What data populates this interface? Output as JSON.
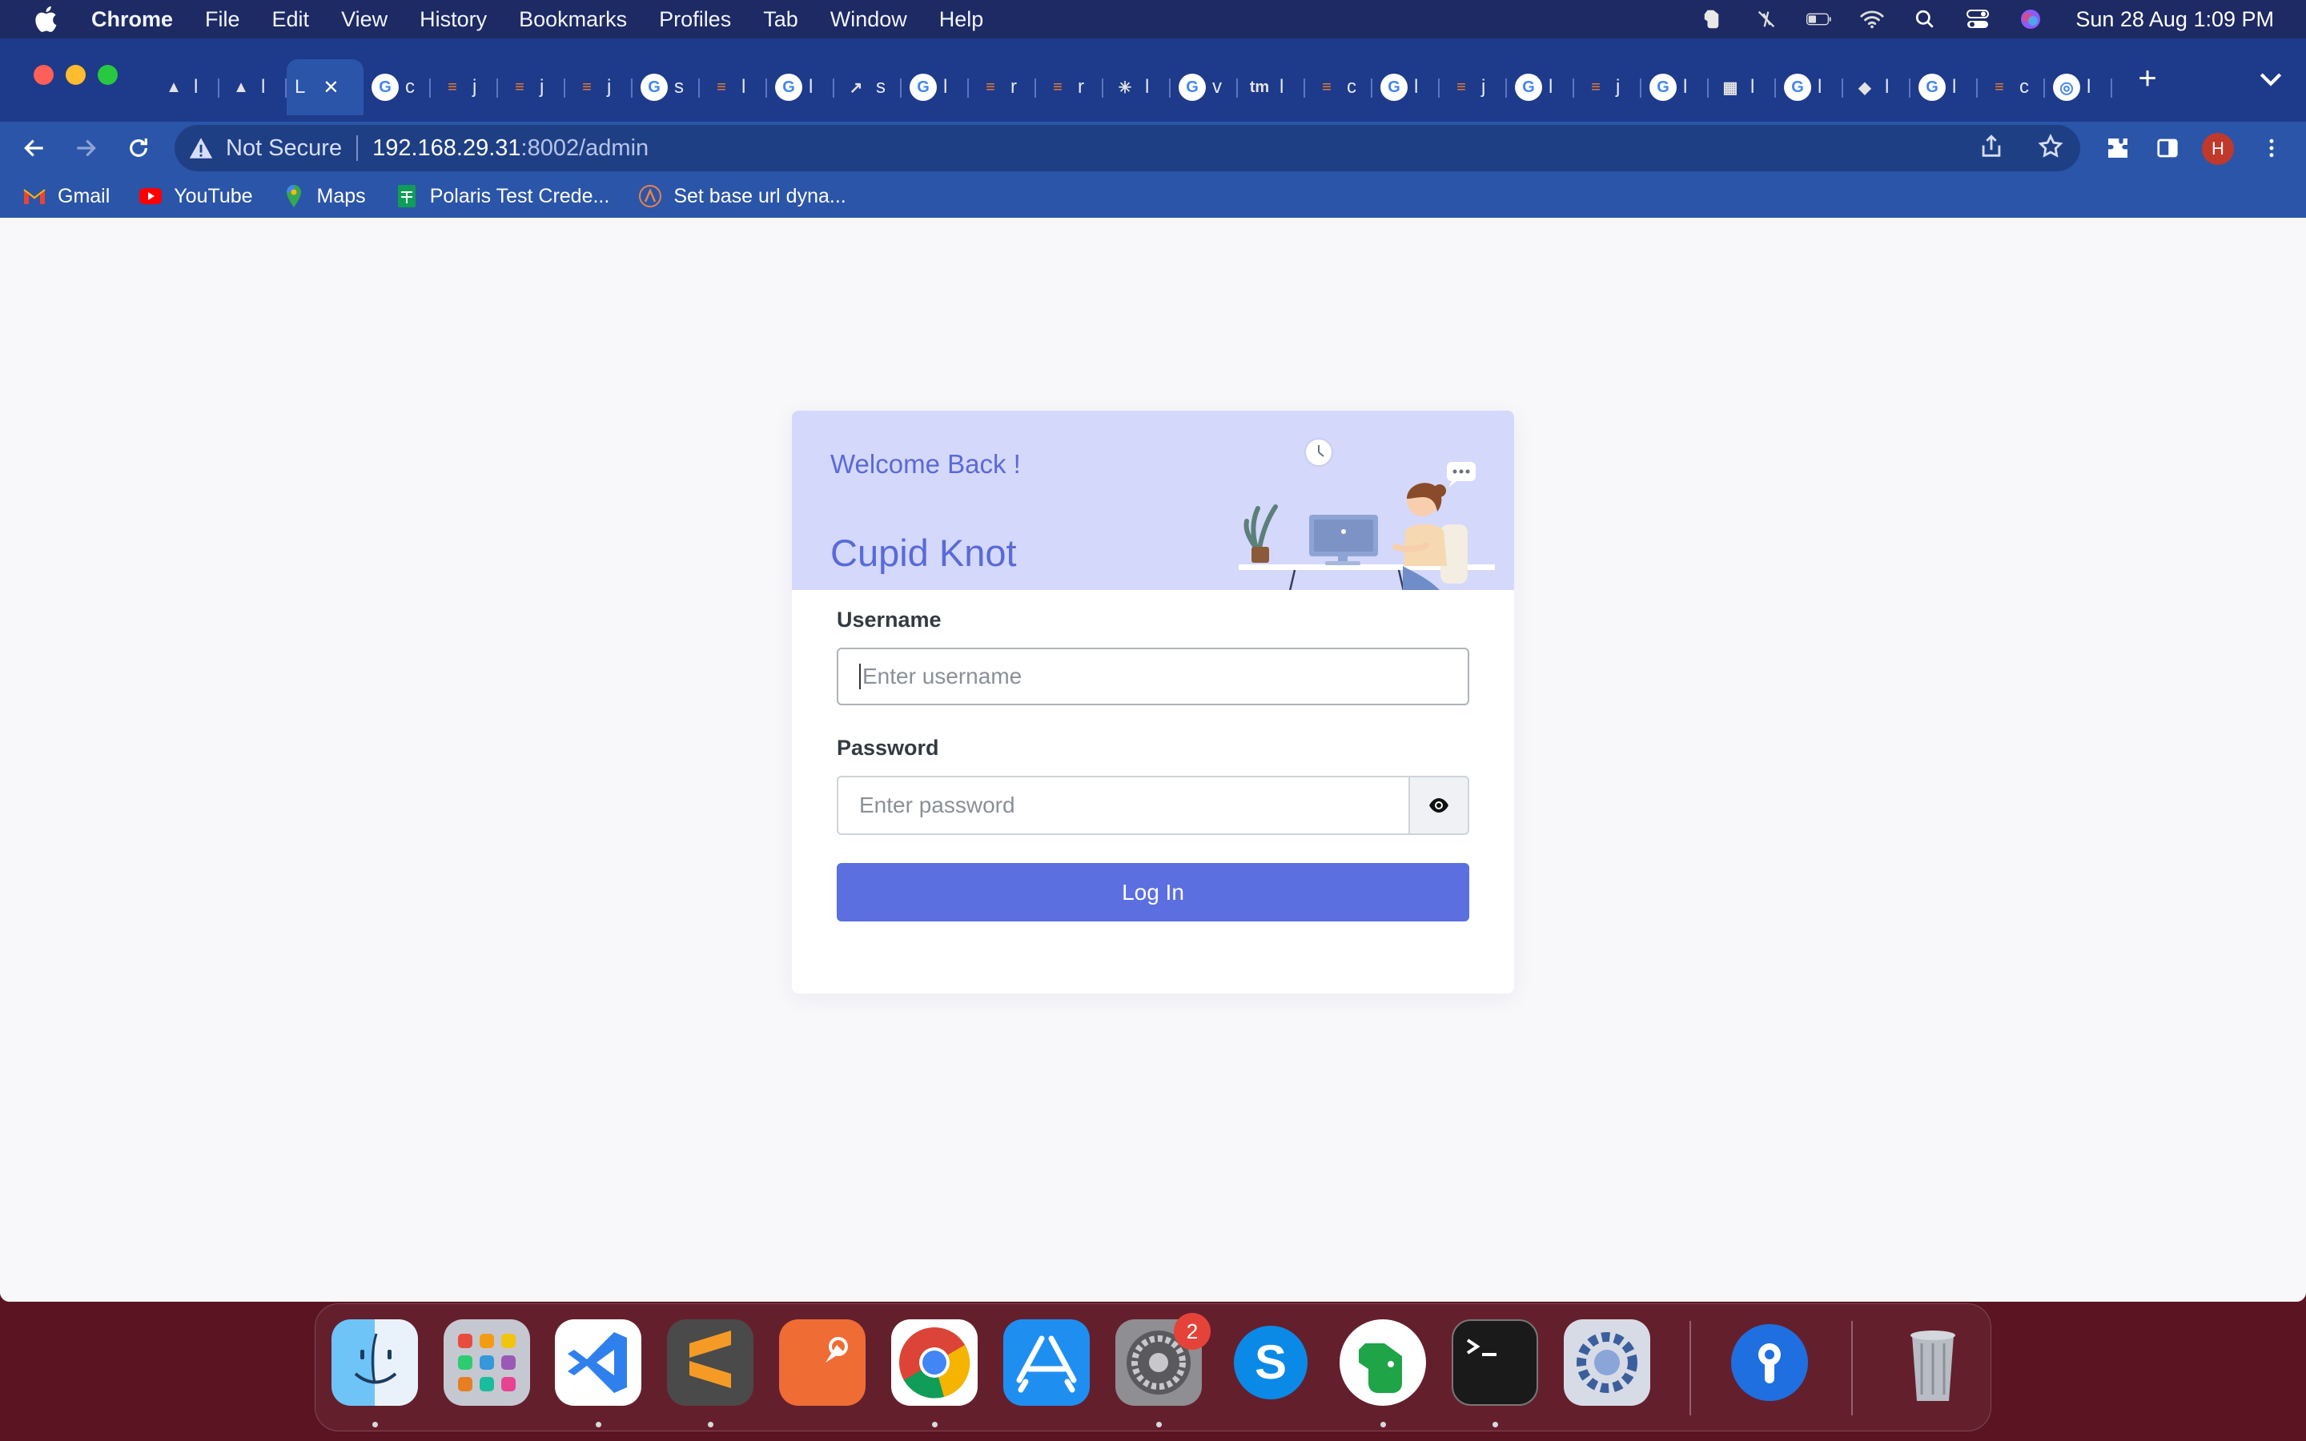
{
  "menubar": {
    "app_name": "Chrome",
    "menus": [
      "File",
      "Edit",
      "View",
      "History",
      "Bookmarks",
      "Profiles",
      "Tab",
      "Window",
      "Help"
    ],
    "clock": "Sun 28 Aug  1:09 PM",
    "status_icons": [
      "evernote-icon",
      "mute-icon",
      "battery-icon",
      "wifi-icon",
      "spotlight-icon",
      "control-center-icon",
      "siri-icon"
    ]
  },
  "browser": {
    "tabs": [
      {
        "icon": "app-logo-icon",
        "text": "l"
      },
      {
        "icon": "app-logo-icon",
        "text": "l"
      },
      {
        "icon": "none",
        "text": "L",
        "active": true
      },
      {
        "icon": "google-icon",
        "text": "c"
      },
      {
        "icon": "stackoverflow-icon",
        "text": "j"
      },
      {
        "icon": "stackoverflow-icon",
        "text": "j"
      },
      {
        "icon": "stackoverflow-icon",
        "text": "j"
      },
      {
        "icon": "google-icon",
        "text": "s"
      },
      {
        "icon": "stackoverflow-icon",
        "text": "l"
      },
      {
        "icon": "google-icon",
        "text": "l"
      },
      {
        "icon": "arrow-icon",
        "text": "s"
      },
      {
        "icon": "google-icon",
        "text": "l"
      },
      {
        "icon": "stackoverflow-icon",
        "text": "r"
      },
      {
        "icon": "stackoverflow-icon",
        "text": "r"
      },
      {
        "icon": "spark-icon",
        "text": "l"
      },
      {
        "icon": "google-icon",
        "text": "v"
      },
      {
        "icon": "tm-icon",
        "text": "l"
      },
      {
        "icon": "stackoverflow-icon",
        "text": "c"
      },
      {
        "icon": "google-icon",
        "text": "l"
      },
      {
        "icon": "stackoverflow-icon",
        "text": "j"
      },
      {
        "icon": "google-icon",
        "text": "l"
      },
      {
        "icon": "stackoverflow-icon",
        "text": "j"
      },
      {
        "icon": "google-icon",
        "text": "l"
      },
      {
        "icon": "grid-icon",
        "text": "l"
      },
      {
        "icon": "google-icon",
        "text": "l"
      },
      {
        "icon": "diamond-icon",
        "text": "l"
      },
      {
        "icon": "google-icon",
        "text": "l"
      },
      {
        "icon": "stackoverflow-icon",
        "text": "c"
      },
      {
        "icon": "chrome-icon",
        "text": "l"
      }
    ],
    "new_tab": "+",
    "address": {
      "security": "Not Secure",
      "host": "192.168.29.31",
      "path": ":8002/admin"
    },
    "profile_initial": "H",
    "bookmarks": [
      {
        "icon": "gmail-icon",
        "label": "Gmail"
      },
      {
        "icon": "youtube-icon",
        "label": "YouTube"
      },
      {
        "icon": "maps-icon",
        "label": "Maps"
      },
      {
        "icon": "sheets-icon",
        "label": "Polaris Test Crede..."
      },
      {
        "icon": "postman-icon",
        "label": "Set base url dyna..."
      }
    ]
  },
  "login": {
    "welcome": "Welcome Back !",
    "brand": "Cupid Knot",
    "username_label": "Username",
    "username_placeholder": "Enter username",
    "password_label": "Password",
    "password_placeholder": "Enter password",
    "login_button": "Log In"
  },
  "dock": {
    "apps": [
      "finder-icon",
      "launchpad-icon",
      "vscode-icon",
      "sublime-icon",
      "postman-icon",
      "chrome-icon",
      "app-store-icon",
      "system-preferences-icon",
      "skype-icon",
      "evernote-icon",
      "terminal-icon",
      "settings-icon",
      "proxyman-icon",
      "trash-icon"
    ],
    "badge": "2"
  },
  "colors": {
    "menubar": "#1d2a63",
    "chrome_frame": "#2b55a8",
    "accent": "#5b6fe0",
    "card_header": "#d4d8fb",
    "page_bg": "#f8f8fb"
  }
}
